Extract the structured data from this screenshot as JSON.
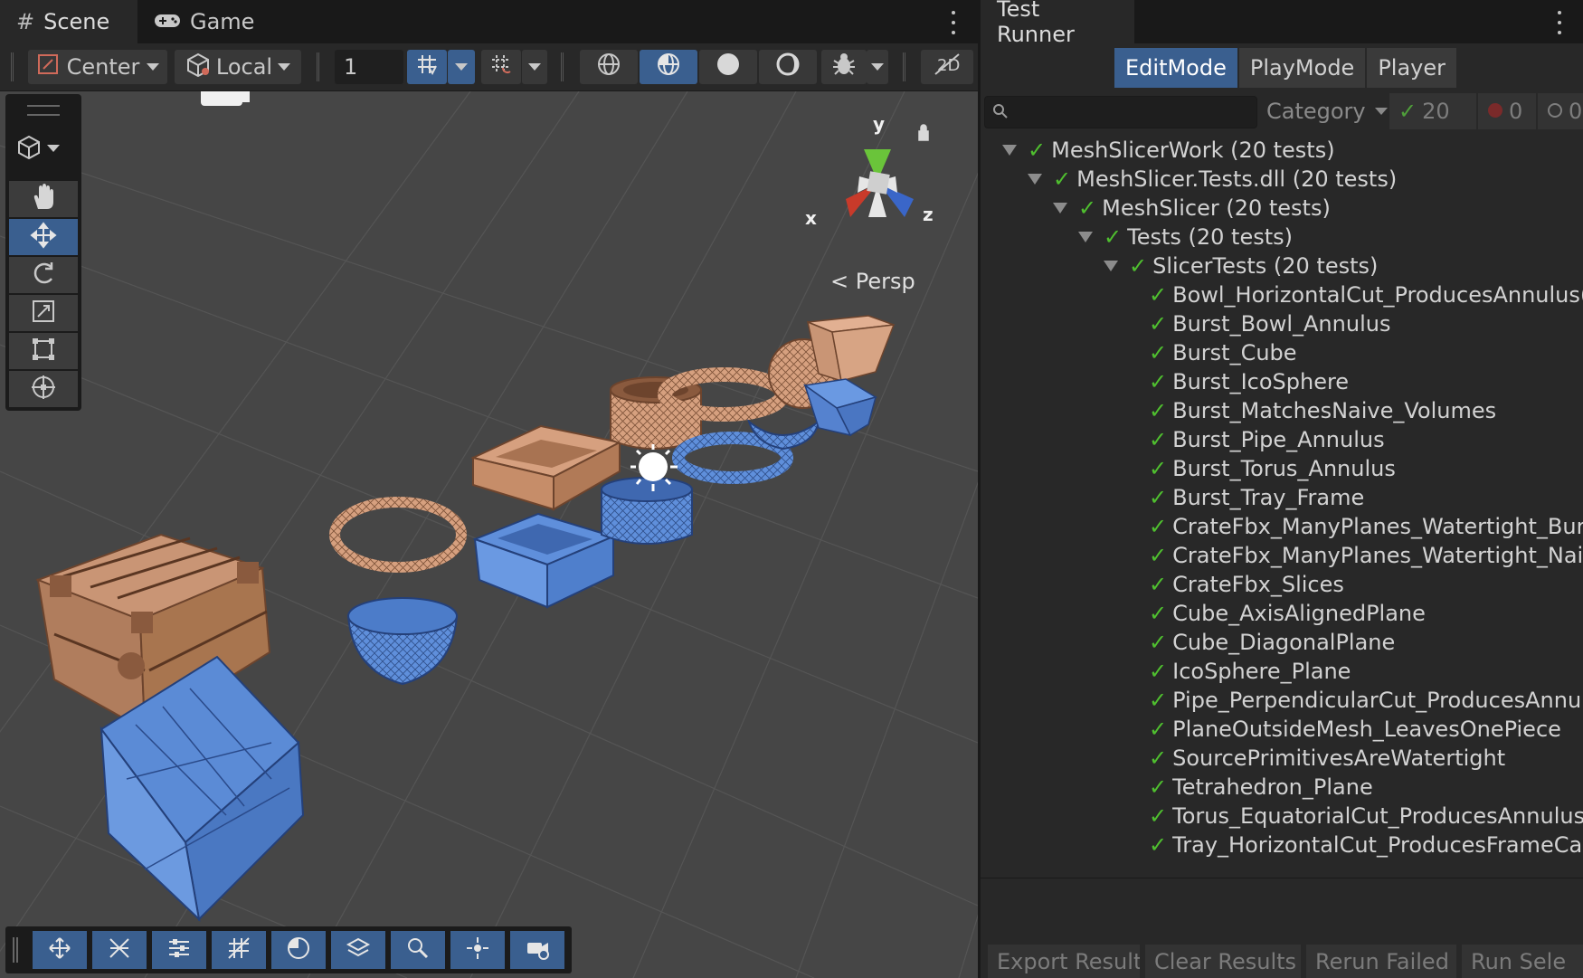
{
  "scene_window": {
    "tabs": [
      {
        "label": "Scene",
        "icon": "hash-grid-icon",
        "active": true
      },
      {
        "label": "Game",
        "icon": "gamepad-icon",
        "active": false
      }
    ],
    "toolbar": {
      "pivot_mode": "Center",
      "pivot_rotation": "Local",
      "grid_value": "1"
    },
    "view_label": "Persp",
    "gizmo_axes": {
      "y": "y",
      "x": "x",
      "z": "z"
    }
  },
  "test_runner": {
    "tab_label": "Test Runner",
    "modes": [
      {
        "label": "EditMode",
        "active": true
      },
      {
        "label": "PlayMode",
        "active": false
      },
      {
        "label": "Player",
        "active": false
      }
    ],
    "search": {
      "placeholder": ""
    },
    "category_label": "Category",
    "counts": {
      "passed": "20",
      "failed": "0",
      "skipped": "0"
    },
    "tree": [
      {
        "label": "MeshSlicerWork (20 tests)",
        "depth": 0,
        "expanded": true
      },
      {
        "label": "MeshSlicer.Tests.dll (20 tests)",
        "depth": 1,
        "expanded": true
      },
      {
        "label": "MeshSlicer (20 tests)",
        "depth": 2,
        "expanded": true
      },
      {
        "label": "Tests (20 tests)",
        "depth": 3,
        "expanded": true
      },
      {
        "label": "SlicerTests (20 tests)",
        "depth": 4,
        "expanded": true
      },
      {
        "label": "Bowl_HorizontalCut_ProducesAnnulus(",
        "depth": 5
      },
      {
        "label": "Burst_Bowl_Annulus",
        "depth": 5
      },
      {
        "label": "Burst_Cube",
        "depth": 5
      },
      {
        "label": "Burst_IcoSphere",
        "depth": 5
      },
      {
        "label": "Burst_MatchesNaive_Volumes",
        "depth": 5
      },
      {
        "label": "Burst_Pipe_Annulus",
        "depth": 5
      },
      {
        "label": "Burst_Torus_Annulus",
        "depth": 5
      },
      {
        "label": "Burst_Tray_Frame",
        "depth": 5
      },
      {
        "label": "CrateFbx_ManyPlanes_Watertight_Burs",
        "depth": 5
      },
      {
        "label": "CrateFbx_ManyPlanes_Watertight_Naiv",
        "depth": 5
      },
      {
        "label": "CrateFbx_Slices",
        "depth": 5
      },
      {
        "label": "Cube_AxisAlignedPlane",
        "depth": 5
      },
      {
        "label": "Cube_DiagonalPlane",
        "depth": 5
      },
      {
        "label": "IcoSphere_Plane",
        "depth": 5
      },
      {
        "label": "Pipe_PerpendicularCut_ProducesAnnul",
        "depth": 5
      },
      {
        "label": "PlaneOutsideMesh_LeavesOnePiece",
        "depth": 5
      },
      {
        "label": "SourcePrimitivesAreWatertight",
        "depth": 5
      },
      {
        "label": "Tetrahedron_Plane",
        "depth": 5
      },
      {
        "label": "Torus_EquatorialCut_ProducesAnnulus",
        "depth": 5
      },
      {
        "label": "Tray_HorizontalCut_ProducesFrameCa",
        "depth": 5
      }
    ],
    "footer": {
      "export": "Export Results",
      "clear": "Clear Results",
      "rerun": "Rerun Failed",
      "run_selected": "Run Sele"
    }
  },
  "colors": {
    "accent": "#3a5f8f",
    "pass": "#4fbf2f",
    "mesh_orange": "#d9a282",
    "mesh_blue": "#5f8fd9",
    "axis_x": "#c83a2a",
    "axis_y": "#6ac43a",
    "axis_z": "#3a66c8"
  }
}
